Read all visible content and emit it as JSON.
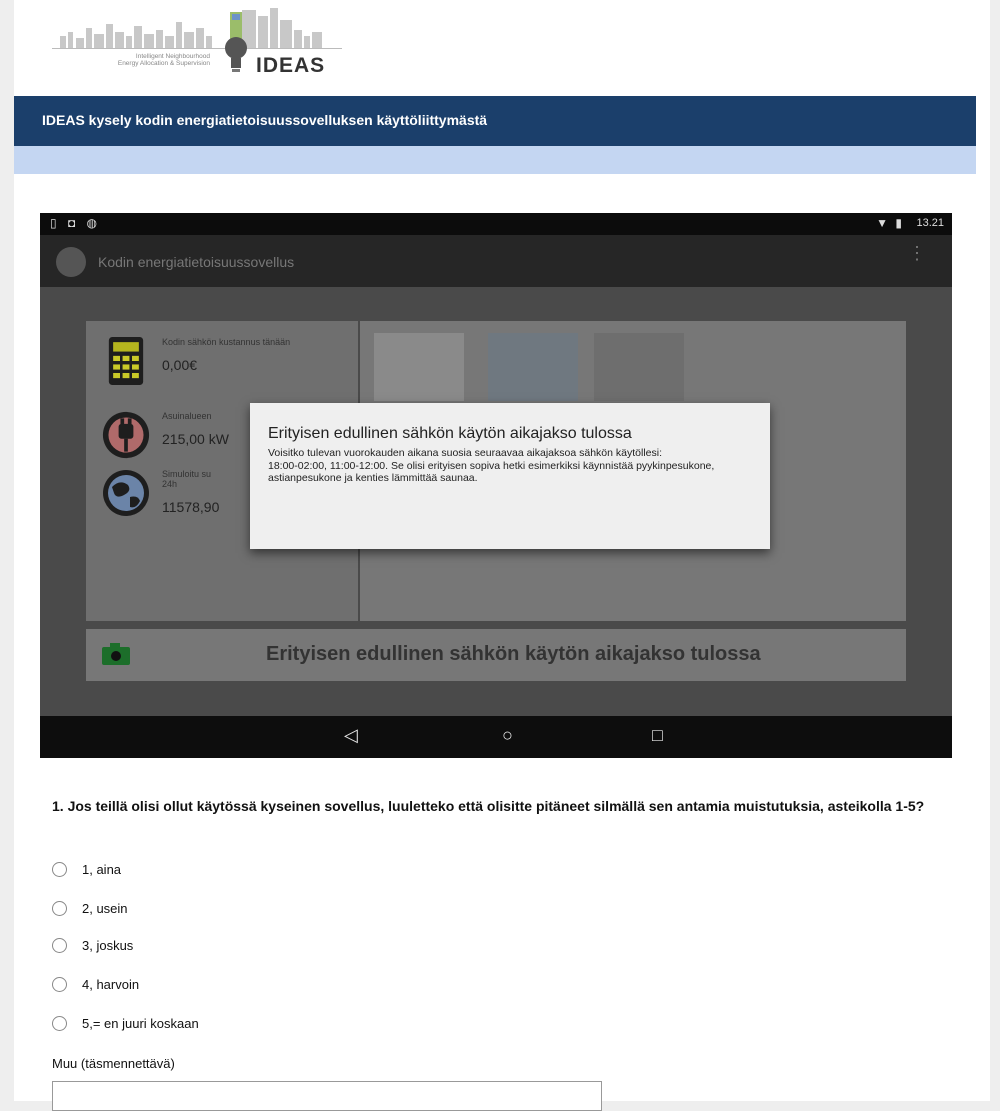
{
  "logo": {
    "tagline_line1": "Intelligent Neighbourhood",
    "tagline_line2": "Energy Allocation & Supervision",
    "brand": "IDEAS"
  },
  "header": {
    "title": "IDEAS kysely kodin energiatietoisuussovelluksen käyttöliittymästä"
  },
  "phone": {
    "status_time": "13.21",
    "app_title": "Kodin energiatietoisuussovellus",
    "stats": [
      {
        "label": "Kodin sähkön kustannus tänään",
        "value": "0,00€",
        "icon": "calculator-icon"
      },
      {
        "label": "Asuinalueen",
        "value": "215,00 kW",
        "icon": "plug-icon"
      },
      {
        "label": "Simuloitu su 24h",
        "value": "11578,90",
        "icon": "globe-icon"
      }
    ],
    "dialog": {
      "title": "Erityisen edullinen sähkön käytön aikajakso tulossa",
      "line1": "Voisitko tulevan vuorokauden aikana suosia seuraavaa aikajaksoa sähkön käytöllesi:",
      "line2": "18:00-02:00, 11:00-12:00. Se olisi erityisen sopiva hetki esimerkiksi käynnistää pyykinpesukone, astianpesukone ja kenties lämmittää saunaa."
    },
    "banner_text": "Erityisen edullinen sähkön käytön aikajakso tulossa",
    "nav": {
      "back": "◁",
      "home": "○",
      "recent": "□"
    },
    "colors": {
      "title_bar": "#1b3f6b",
      "sub_bar": "#c4d6f2"
    }
  },
  "survey": {
    "question": "1. Jos teillä olisi ollut käytössä kyseinen sovellus, luuletteko että olisitte pitäneet silmällä sen antamia muistutuksia, asteikolla 1-5?",
    "options": [
      "1, aina",
      "2, usein",
      "3, joskus",
      "4, harvoin",
      "5,= en juuri koskaan"
    ],
    "other_label": "Muu (täsmennettävä)",
    "other_value": ""
  }
}
